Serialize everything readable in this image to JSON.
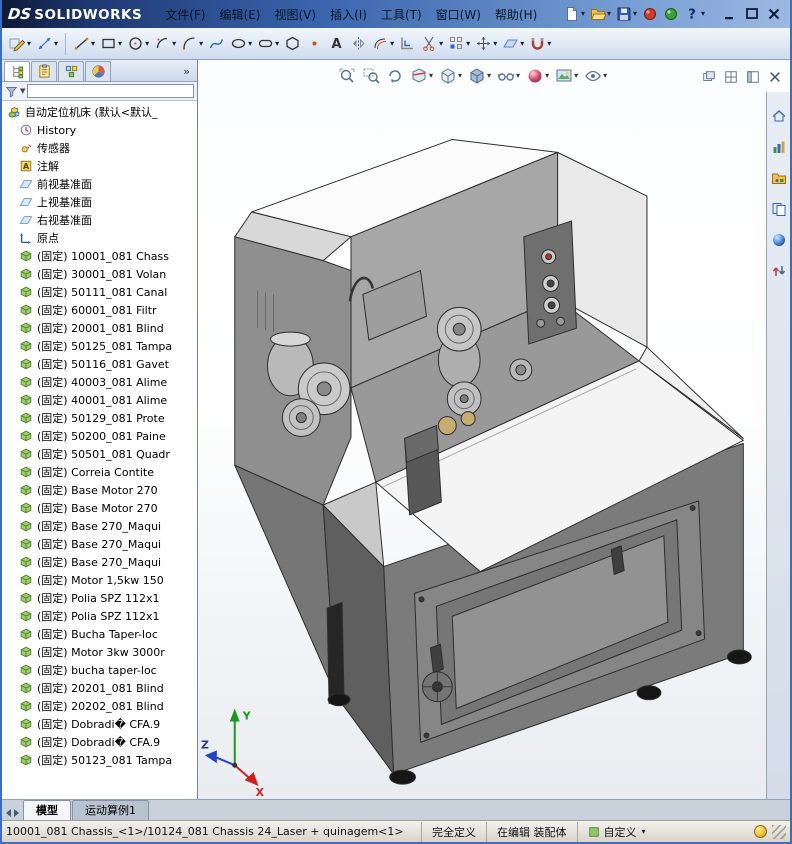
{
  "colors": {
    "titlebar_blue_dark": "#0e1a38",
    "titlebar_blue_light": "#9db9e2",
    "toolbar_bg": "#dbe5f1",
    "viewport_bg": "#ffffff",
    "statusbar_bg": "#d8d4cb",
    "part_icon_green": "#9ed06c",
    "plane_icon_blue": "#cfe0f2",
    "axis_x_red": "#cc2222",
    "axis_y_green": "#1a9a1a",
    "axis_z_blue": "#2244cc",
    "help_ball_yellow": "#e8b323"
  },
  "titlebar": {
    "brand_mark": "DS",
    "brand": "SOLIDWORKS",
    "menu": [
      {
        "name": "file",
        "label": "文件(F)"
      },
      {
        "name": "edit",
        "label": "编辑(E)"
      },
      {
        "name": "view",
        "label": "视图(V)"
      },
      {
        "name": "insert",
        "label": "插入(I)"
      },
      {
        "name": "tools",
        "label": "工具(T)"
      },
      {
        "name": "window",
        "label": "窗口(W)"
      },
      {
        "name": "help",
        "label": "帮助(H)"
      }
    ],
    "tools": [
      {
        "icon": "new-document",
        "dropdown": true
      },
      {
        "icon": "open-folder",
        "dropdown": true
      },
      {
        "icon": "save",
        "dropdown": true
      },
      {
        "icon": "red-sphere",
        "dropdown": false
      },
      {
        "icon": "green-sphere",
        "dropdown": false
      },
      {
        "icon": "help-question",
        "dropdown": true
      }
    ],
    "window_buttons": [
      "minimize",
      "maximize",
      "close"
    ]
  },
  "sketch_toolbar": [
    {
      "icon": "sketch",
      "dropdown": true
    },
    {
      "icon": "smart-dimension",
      "dropdown": true
    },
    {
      "sep": true
    },
    {
      "icon": "line",
      "dropdown": true
    },
    {
      "icon": "rectangle",
      "dropdown": true
    },
    {
      "icon": "circle",
      "dropdown": true
    },
    {
      "icon": "centerpoint-arc",
      "dropdown": true
    },
    {
      "icon": "tangent-arc",
      "dropdown": true
    },
    {
      "icon": "spline",
      "dropdown": false
    },
    {
      "icon": "ellipse",
      "dropdown": true
    },
    {
      "icon": "slot",
      "dropdown": true
    },
    {
      "icon": "polygon",
      "dropdown": false
    },
    {
      "icon": "point",
      "dropdown": false
    },
    {
      "icon": "text",
      "dropdown": false
    },
    {
      "icon": "mirror-entities",
      "dropdown": false
    },
    {
      "icon": "offset-entities",
      "dropdown": true
    },
    {
      "icon": "convert-entities",
      "dropdown": false
    },
    {
      "icon": "trim-entities",
      "dropdown": true
    },
    {
      "icon": "linear-pattern",
      "dropdown": true
    },
    {
      "icon": "move-entities",
      "dropdown": true
    },
    {
      "icon": "plane",
      "dropdown": true
    },
    {
      "icon": "quick-snaps",
      "dropdown": true
    }
  ],
  "panel": {
    "tabs": [
      {
        "icon": "featuremanager-tree",
        "active": true
      },
      {
        "icon": "propertymanager",
        "active": false
      },
      {
        "icon": "configurationmanager",
        "active": false
      },
      {
        "icon": "displaymanager",
        "active": false
      }
    ],
    "expand_chevrons": "»",
    "filter": {
      "value": ""
    },
    "tree": {
      "root": {
        "icon": "assembly",
        "label": "自动定位机床  (默认<默认_"
      },
      "items": [
        {
          "icon": "history",
          "label": "History"
        },
        {
          "icon": "sensor",
          "label": "传感器"
        },
        {
          "icon": "annotation",
          "label": "注解"
        },
        {
          "icon": "plane",
          "label": "前视基准面"
        },
        {
          "icon": "plane",
          "label": "上视基准面"
        },
        {
          "icon": "plane",
          "label": "右视基准面"
        },
        {
          "icon": "origin",
          "label": "原点"
        },
        {
          "icon": "part",
          "label": "(固定) 10001_081 Chass"
        },
        {
          "icon": "part",
          "label": "(固定) 30001_081 Volan"
        },
        {
          "icon": "part",
          "label": "(固定) 50111_081 Canal"
        },
        {
          "icon": "part",
          "label": "(固定) 60001_081 Filtr"
        },
        {
          "icon": "part",
          "label": "(固定) 20001_081 Blind"
        },
        {
          "icon": "part",
          "label": "(固定) 50125_081 Tampa"
        },
        {
          "icon": "part",
          "label": "(固定) 50116_081 Gavet"
        },
        {
          "icon": "part",
          "label": "(固定) 40003_081 Alime"
        },
        {
          "icon": "part",
          "label": "(固定) 40001_081 Alime"
        },
        {
          "icon": "part",
          "label": "(固定) 50129_081 Prote"
        },
        {
          "icon": "part",
          "label": "(固定) 50200_081 Paine"
        },
        {
          "icon": "part",
          "label": "(固定) 50501_081 Quadr"
        },
        {
          "icon": "part",
          "label": "(固定) Correia Contite"
        },
        {
          "icon": "part",
          "label": "(固定) Base Motor 270"
        },
        {
          "icon": "part",
          "label": "(固定) Base Motor 270"
        },
        {
          "icon": "part",
          "label": "(固定) Base  270_Maqui"
        },
        {
          "icon": "part",
          "label": "(固定) Base  270_Maqui"
        },
        {
          "icon": "part",
          "label": "(固定) Base  270_Maqui"
        },
        {
          "icon": "part",
          "label": "(固定) Motor 1,5kw 150"
        },
        {
          "icon": "part",
          "label": "(固定) Polia SPZ 112x1"
        },
        {
          "icon": "part",
          "label": "(固定) Polia SPZ 112x1"
        },
        {
          "icon": "part",
          "label": "(固定) Bucha Taper-loc"
        },
        {
          "icon": "part",
          "label": "(固定) Motor 3kw 3000r"
        },
        {
          "icon": "part",
          "label": "(固定) bucha taper-loc"
        },
        {
          "icon": "part",
          "label": "(固定) 20201_081 Blind"
        },
        {
          "icon": "part",
          "label": "(固定) 20202_081 Blind"
        },
        {
          "icon": "part",
          "label": "(固定) Dobradi� CFA.9"
        },
        {
          "icon": "part",
          "label": "(固定) Dobradi� CFA.9"
        },
        {
          "icon": "part",
          "label": "(固定) 50123_081 Tampa"
        }
      ]
    }
  },
  "viewport": {
    "headsup": [
      {
        "icon": "zoom-fit",
        "dropdown": false
      },
      {
        "icon": "zoom-area",
        "dropdown": false
      },
      {
        "icon": "rotate-view",
        "dropdown": false
      },
      {
        "icon": "section-view",
        "dropdown": true
      },
      {
        "icon": "view-orientation",
        "dropdown": true
      },
      {
        "icon": "display-style",
        "dropdown": true
      },
      {
        "icon": "hide-show-items",
        "dropdown": true
      },
      {
        "icon": "edit-appearance",
        "dropdown": true
      },
      {
        "icon": "apply-scene",
        "dropdown": true
      },
      {
        "icon": "view-settings",
        "dropdown": true
      }
    ],
    "doc_controls": [
      "cascade-windows",
      "split-window",
      "collapse-panel",
      "close-doc"
    ],
    "triad": {
      "x": "X",
      "y": "Y",
      "z": "Z"
    }
  },
  "taskpane": [
    "home",
    "resources-chart",
    "design-library",
    "view-palette",
    "appearances-globe",
    "custom-properties"
  ],
  "tabs_bar": {
    "tabs": [
      {
        "name": "model",
        "label": "模型",
        "active": true
      },
      {
        "name": "motion-study-1",
        "label": "运动算例1",
        "active": false
      }
    ]
  },
  "statusbar": {
    "message": "10001_081 Chassis_<1>/10124_081 Chassis 24_Laser + quinagem<1>",
    "defined": "完全定义",
    "editing": "在编辑 装配体",
    "custom": "自定义"
  }
}
